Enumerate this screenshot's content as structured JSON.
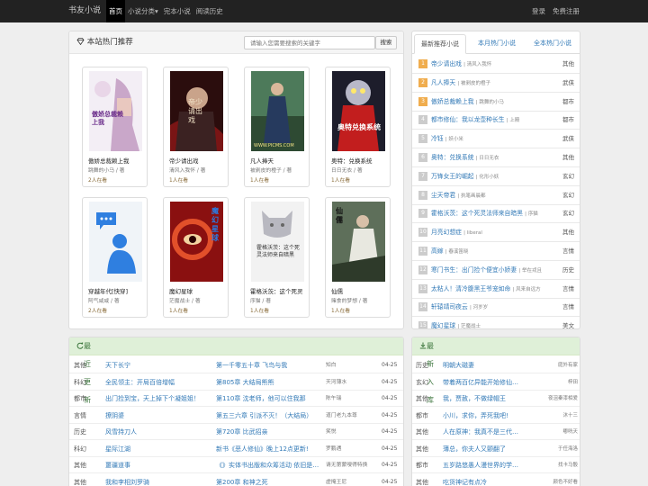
{
  "nav": {
    "brand": "书友小说",
    "items": [
      "首页",
      "小说分类▾",
      "完本小说",
      "阅读历史"
    ],
    "login": "登录",
    "register": "免费注册"
  },
  "hot": {
    "title": "本站热门推荐",
    "search_placeholder": "请输入您需要搜索的关键字",
    "search_button": "搜索",
    "books": [
      {
        "name": "傲娇总裁赖上我",
        "author": "跳舞的小马 / 著",
        "reads": "2人在看",
        "cover_text": "傲娇总裁赖上我"
      },
      {
        "name": "帝少请出戏",
        "author": "清风入我怀 / 著",
        "reads": "1人在看",
        "cover_text": "帝少请出戏"
      },
      {
        "name": "凡人捧天",
        "author": "被剥皮的橙子 / 著",
        "reads": "1人在看",
        "cover_text": "WWW.PICMS.COM"
      },
      {
        "name": "奥特：兑换系统",
        "author": "日日无衣 / 著",
        "reads": "1人在看",
        "cover_text": "奥特兑换系统"
      },
      {
        "name": "穿越年代[快穿]",
        "author": "阿气咸咸 / 著",
        "reads": "2人在看",
        "cover_text": ""
      },
      {
        "name": "魔幻星球",
        "author": "茫魔战士 / 著",
        "reads": "1人在看",
        "cover_text": "魔幻星球"
      },
      {
        "name": "霍格沃茨：这个死灵",
        "author": "序猫 / 著",
        "reads": "1人在看",
        "cover_text": "霍格沃茨：这个死灵法师来自暗黑"
      },
      {
        "name": "仙儒",
        "author": "赌食的梦想 / 著",
        "reads": "1人在看",
        "cover_text": "仙儒"
      }
    ]
  },
  "side": {
    "tabs": [
      "最新推荐小说",
      "本月热门小说",
      "全本热门小说"
    ],
    "ranks": [
      {
        "no": "1",
        "name": "帝少请出戏",
        "author": "清风入我怀",
        "cat": "其他"
      },
      {
        "no": "2",
        "name": "凡人捧天",
        "author": "被剥皮的橙子",
        "cat": "武侠"
      },
      {
        "no": "3",
        "name": "傲娇总裁赖上我",
        "author": "跳舞的小马",
        "cat": "都市"
      },
      {
        "no": "4",
        "name": "都市修仙：我以龙壶种长生",
        "author": "上殿",
        "cat": "都市"
      },
      {
        "no": "5",
        "name": "冷钰",
        "author": "妖小米",
        "cat": "武侠"
      },
      {
        "no": "6",
        "name": "奥特：兑换系统",
        "author": "日日无衣",
        "cat": "其他"
      },
      {
        "no": "7",
        "name": "万锋女王的崛起",
        "author": "化形小妖",
        "cat": "玄幻"
      },
      {
        "no": "8",
        "name": "尘天帝君",
        "author": "执笔画晨都",
        "cat": "玄幻"
      },
      {
        "no": "9",
        "name": "霍格沃茨：这个死灵法师来自暗黑",
        "author": "序猫",
        "cat": "玄幻"
      },
      {
        "no": "10",
        "name": "月亮幻想症",
        "author": "liberal",
        "cat": "其他"
      },
      {
        "no": "11",
        "name": "高嫁",
        "author": "春溪笛晓",
        "cat": "言情"
      },
      {
        "no": "12",
        "name": "寒门书生：出门捡个便宜小娇妻",
        "author": "举在戎且",
        "cat": "历史"
      },
      {
        "no": "13",
        "name": "太粘人！清冷腹黑王爷宠如命",
        "author": "风来自远方",
        "cat": "言情"
      },
      {
        "no": "14",
        "name": "轩辕靖司夜云",
        "author": "河岁岁",
        "cat": "言情"
      },
      {
        "no": "15",
        "name": "魔幻星球",
        "author": "茫魔战士",
        "cat": "美文"
      }
    ]
  },
  "updates": {
    "title": "最近更新",
    "rows": [
      {
        "cat": "其他",
        "book": "天下长宁",
        "chapter": "第一千零五十章 飞鸟与我",
        "author": "知白",
        "date": "04-25"
      },
      {
        "cat": "科幻",
        "book": "全民领主：开局百倍增幅",
        "chapter": "第805章 大结局熊熊",
        "author": "天河薄水",
        "date": "04-25"
      },
      {
        "cat": "都市",
        "book": "出门捡到宝，天上掉下个凝姐姐！",
        "chapter": "第110章 沈老师，他可以住我那",
        "author": "陈午瑞",
        "date": "04-25"
      },
      {
        "cat": "言情",
        "book": "撩阴婆",
        "chapter": "第五三六章 引派不灭！（大结局）",
        "author": "道门老九本尊",
        "date": "04-25"
      },
      {
        "cat": "历史",
        "book": "风雪持刀人",
        "chapter": "第720章 比武招亲",
        "author": "笑悦",
        "date": "04-25"
      },
      {
        "cat": "科幻",
        "book": "星际江湖",
        "chapter": "新书《恶人修仙》晚上12点更新!",
        "author": "罗鹏遇",
        "date": "04-25"
      },
      {
        "cat": "其他",
        "book": "噩疆道事",
        "chapter": "《》实体书出版和众筹活动 依旧是…",
        "author": "请无第蒙嗖得特换",
        "date": "04-25"
      },
      {
        "cat": "其他",
        "book": "我和李相刘罗骑",
        "chapter": "第200章 和神之死",
        "author": "虚掩王尼",
        "date": "04-25"
      }
    ]
  },
  "newin": {
    "title": "最新入库",
    "rows": [
      {
        "cat": "历史",
        "book": "明朝大磁妻",
        "author": "庭外有家"
      },
      {
        "cat": "玄幻",
        "book": "带着两百亿异能开始修仙…",
        "author": "梓田"
      },
      {
        "cat": "其他",
        "book": "我，贾赦，不做绿帽王",
        "author": "夜沮秦漆相爱"
      },
      {
        "cat": "都市",
        "book": "小川，求你，弄死我吧!",
        "author": "沐十三"
      },
      {
        "cat": "其他",
        "book": "人在原神：我真不是三代…",
        "author": "嘟咣天"
      },
      {
        "cat": "其他",
        "book": "薄总，你夫人又颤翻了",
        "author": "于任海洛"
      },
      {
        "cat": "都市",
        "book": "五岁路悠愚人漫世界的学…",
        "author": "找卡马骰"
      },
      {
        "cat": "其他",
        "book": "吃货神记有点冷",
        "author": "颜色不好看"
      }
    ]
  }
}
